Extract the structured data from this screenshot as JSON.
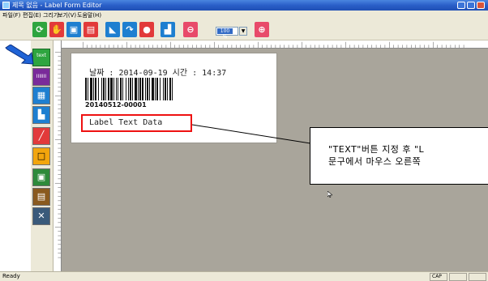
{
  "window": {
    "title": "제목 없음 - Label Form Editor"
  },
  "menubar": {
    "items": [
      "파일(F)",
      "편집(E)",
      "그리기",
      "보기(V)",
      "도움말(H)"
    ]
  },
  "toolbar": {
    "zoom_value": "100 %",
    "zoom_arrow": "▼"
  },
  "sidebar": {
    "text_button": "text",
    "barcode_button": "IIIIIII"
  },
  "label": {
    "datetime": "날짜 : 2014-09-19  시간 : 14:37",
    "barcode_value": "20140512-00001",
    "text_data": "Label Text Data"
  },
  "callout": {
    "line1": "\"TEXT\"버튼 지정 후 \"L",
    "line2": "문구에서 마우스 오른쪽"
  },
  "status": {
    "text": "Ready",
    "caps": "CAP"
  },
  "colors": {
    "canvas_bg": "#a9a59b",
    "highlight": "#ee1111",
    "arrow": "#1f63d6"
  }
}
